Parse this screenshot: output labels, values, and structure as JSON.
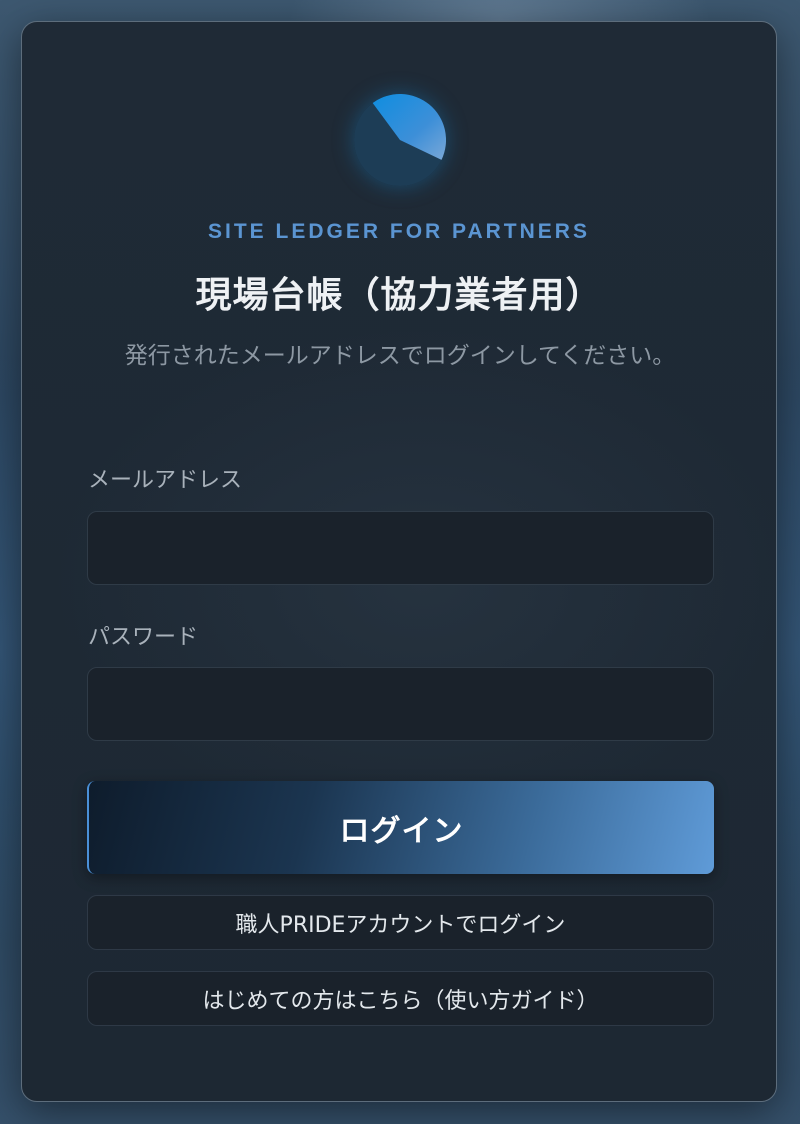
{
  "brand": {
    "eyebrow": "SITE LEDGER FOR PARTNERS",
    "logo_icon": "pie-logo-icon",
    "accent_color": "#5b95d2"
  },
  "header": {
    "title": "現場台帳（協力業者用）",
    "subtitle": "発行されたメールアドレスでログインしてください。"
  },
  "form": {
    "email": {
      "label": "メールアドレス",
      "value": "",
      "placeholder": ""
    },
    "password": {
      "label": "パスワード",
      "value": "",
      "placeholder": ""
    }
  },
  "buttons": {
    "login": "ログイン",
    "pride_login": "職人PRIDEアカウントでログイン",
    "guide": "はじめての方はこちら（使い方ガイド）"
  },
  "colors": {
    "card_background": "#1f2a36",
    "primary_gradient_start": "#0e1c2c",
    "primary_gradient_end": "#5f9bd8"
  }
}
